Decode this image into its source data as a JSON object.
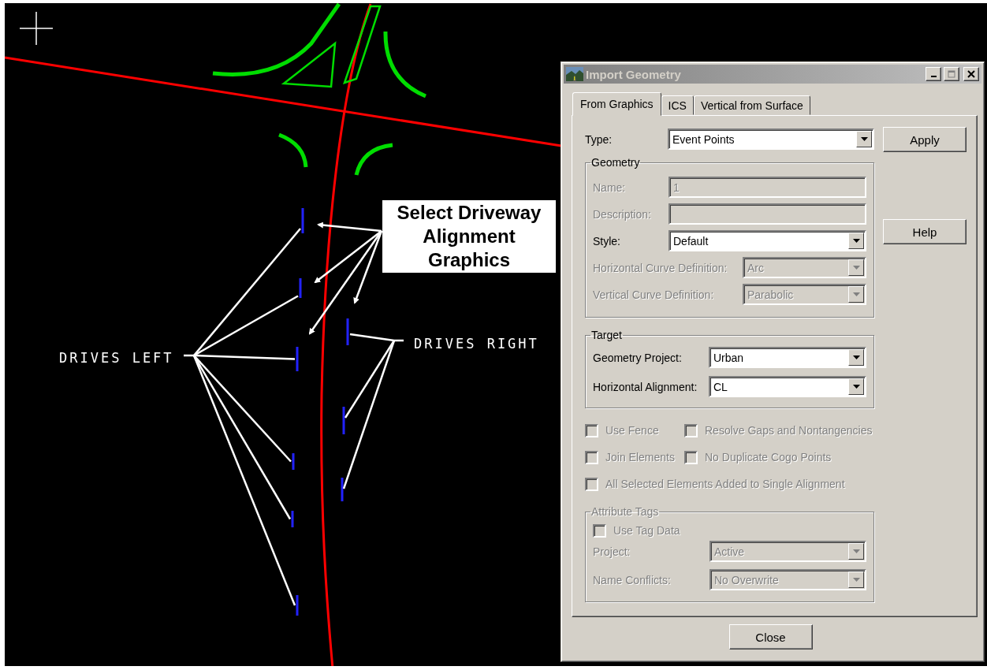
{
  "canvas": {
    "callout": "Select Driveway Alignment Graphics",
    "labels": [
      {
        "text": "DRIVES LEFT"
      },
      {
        "text": "DRIVES RIGHT"
      }
    ]
  },
  "dialog": {
    "title": "Import Geometry",
    "tabs": [
      {
        "label": "From Graphics",
        "selected": true
      },
      {
        "label": "ICS",
        "selected": false
      },
      {
        "label": "Vertical from Surface",
        "selected": false
      }
    ],
    "type": {
      "kind": "select",
      "label": "Type:",
      "value": "Event Points",
      "disabled": false
    },
    "geometry": {
      "legend": "Geometry",
      "fields": [
        {
          "kind": "text",
          "label": "Name:",
          "value": "1",
          "disabled": true
        },
        {
          "kind": "text",
          "label": "Description:",
          "disabled": true
        },
        {
          "kind": "select",
          "label": "Style:",
          "value": "Default",
          "disabled": false
        }
      ],
      "curves": [
        {
          "kind": "select",
          "label": "Horizontal Curve Definition:",
          "value": "Arc",
          "disabled": true
        },
        {
          "kind": "select",
          "label": "Vertical Curve Definition:",
          "value": "Parabolic",
          "disabled": true
        }
      ]
    },
    "target": {
      "legend": "Target",
      "fields": [
        {
          "kind": "select",
          "label": "Geometry Project:",
          "value": "Urban",
          "disabled": false
        },
        {
          "kind": "select",
          "label": "Horizontal Alignment:",
          "value": "CL",
          "disabled": false
        }
      ]
    },
    "options": [
      [
        {
          "label": "Use Fence",
          "checked": false,
          "disabled": true
        },
        {
          "label": "Resolve Gaps and Nontangencies",
          "checked": false,
          "disabled": true
        }
      ],
      [
        {
          "label": "Join Elements",
          "checked": false,
          "disabled": true
        },
        {
          "label": "No Duplicate Cogo Points",
          "checked": false,
          "disabled": true
        }
      ],
      [
        {
          "label": "All Selected Elements Added to Single Alignment",
          "checked": false,
          "disabled": true
        }
      ]
    ],
    "attribute_tags": {
      "legend": "Attribute Tags",
      "use_tag_data": {
        "label": "Use Tag Data",
        "checked": false,
        "disabled": true
      },
      "fields": [
        {
          "kind": "select",
          "label": "Project:",
          "value": "Active",
          "disabled": true
        },
        {
          "kind": "select",
          "label": "Name Conflicts:",
          "value": "No Overwrite",
          "disabled": true
        }
      ]
    },
    "buttons": [
      {
        "label": "Apply"
      },
      {
        "label": "Help"
      }
    ],
    "close_button": "Close"
  }
}
